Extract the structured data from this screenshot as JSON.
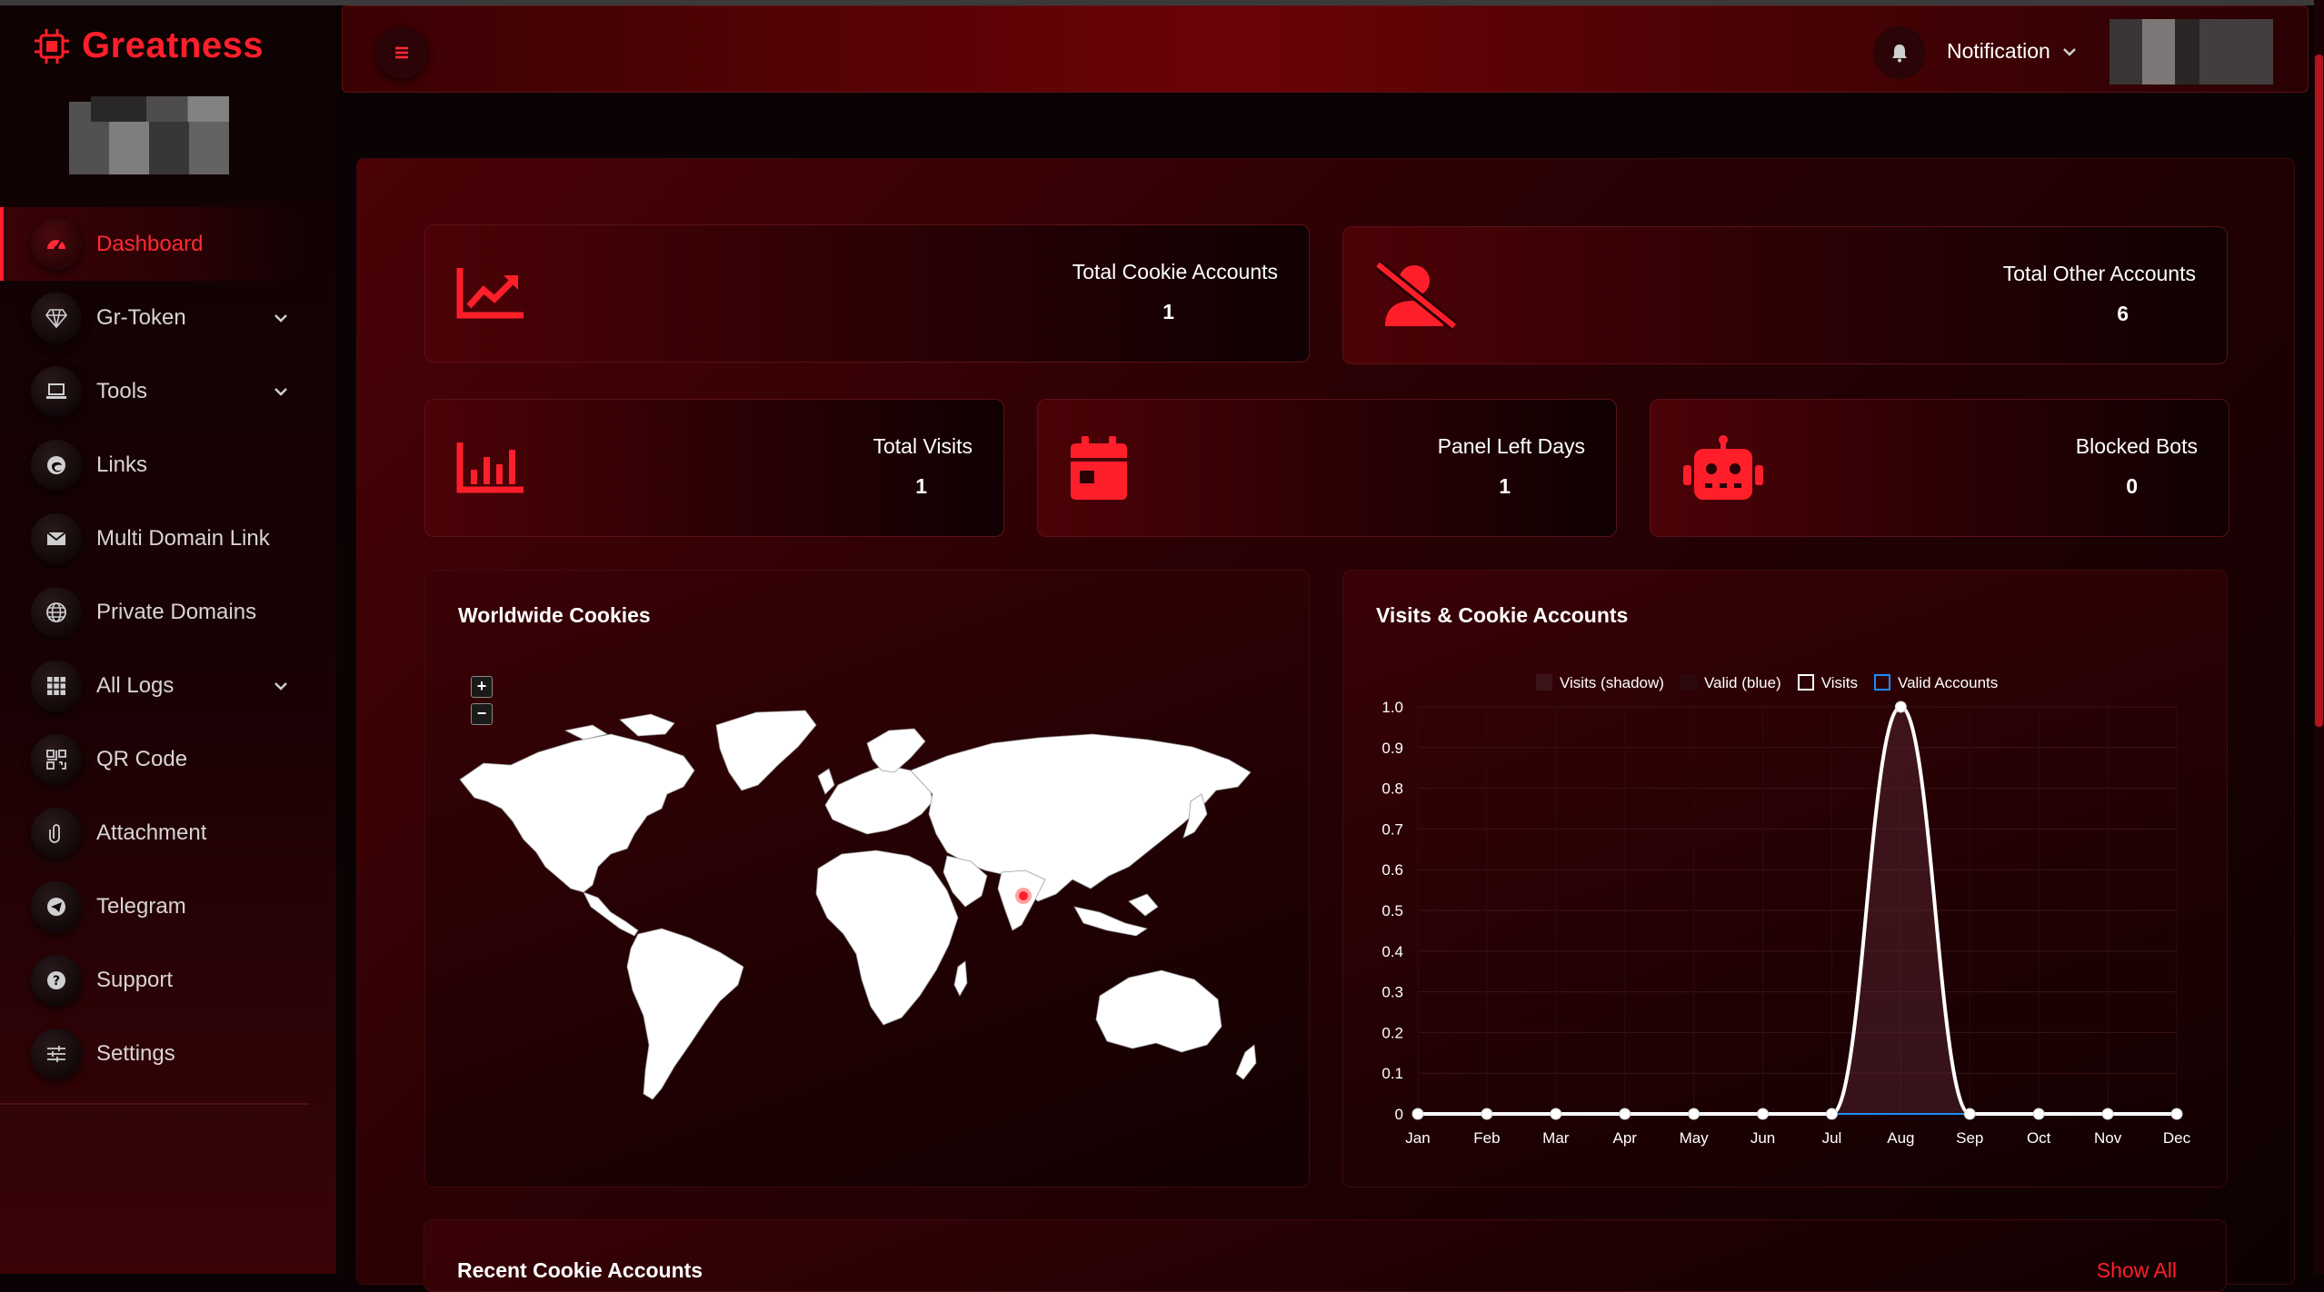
{
  "brand": {
    "name": "Greatness",
    "accent": "#ff1f2a"
  },
  "sidebar": {
    "items": [
      {
        "label": "Dashboard",
        "icon": "speedometer-icon",
        "active": true,
        "chevron": false
      },
      {
        "label": "Gr-Token",
        "icon": "diamond-icon",
        "active": false,
        "chevron": true
      },
      {
        "label": "Tools",
        "icon": "laptop-icon",
        "active": false,
        "chevron": true
      },
      {
        "label": "Links",
        "icon": "edge-browser-icon",
        "active": false,
        "chevron": false
      },
      {
        "label": "Multi Domain Link",
        "icon": "envelope-icon",
        "active": false,
        "chevron": false
      },
      {
        "label": "Private Domains",
        "icon": "globe-icon",
        "active": false,
        "chevron": false
      },
      {
        "label": "All Logs",
        "icon": "grid-icon",
        "active": false,
        "chevron": true
      },
      {
        "label": "QR Code",
        "icon": "qr-code-icon",
        "active": false,
        "chevron": false
      },
      {
        "label": "Attachment",
        "icon": "paperclip-icon",
        "active": false,
        "chevron": false
      },
      {
        "label": "Telegram",
        "icon": "telegram-icon",
        "active": false,
        "chevron": false
      },
      {
        "label": "Support",
        "icon": "question-icon",
        "active": false,
        "chevron": false
      },
      {
        "label": "Settings",
        "icon": "sliders-icon",
        "active": false,
        "chevron": false
      }
    ]
  },
  "header": {
    "notification_label": "Notification"
  },
  "stats": {
    "cookie_accounts": {
      "label": "Total Cookie Accounts",
      "value": "1",
      "icon": "trending-chart-icon"
    },
    "other_accounts": {
      "label": "Total Other Accounts",
      "value": "6",
      "icon": "user-slash-icon"
    },
    "visits": {
      "label": "Total Visits",
      "value": "1",
      "icon": "bar-chart-icon"
    },
    "panel_days": {
      "label": "Panel Left Days",
      "value": "1",
      "icon": "calendar-icon"
    },
    "blocked_bots": {
      "label": "Blocked Bots",
      "value": "0",
      "icon": "robot-icon"
    }
  },
  "map": {
    "title": "Worldwide Cookies",
    "zoom_in": "+",
    "zoom_out": "−",
    "marker": "India"
  },
  "chart": {
    "title": "Visits & Cookie Accounts",
    "legend": [
      "Visits (shadow)",
      "Valid (blue)",
      "Visits",
      "Valid Accounts"
    ]
  },
  "chart_data": {
    "type": "line",
    "categories": [
      "Jan",
      "Feb",
      "Mar",
      "Apr",
      "May",
      "Jun",
      "Jul",
      "Aug",
      "Sep",
      "Oct",
      "Nov",
      "Dec"
    ],
    "series": [
      {
        "name": "Visits",
        "values": [
          0,
          0,
          0,
          0,
          0,
          0,
          0,
          1,
          0,
          0,
          0,
          0
        ]
      },
      {
        "name": "Valid Accounts",
        "values": [
          0,
          0,
          0,
          0,
          0,
          0,
          0,
          0,
          0,
          0,
          0,
          0
        ]
      }
    ],
    "yticks": [
      "0",
      "0.1",
      "0.2",
      "0.3",
      "0.4",
      "0.5",
      "0.6",
      "0.7",
      "0.8",
      "0.9",
      "1.0"
    ],
    "ylim": [
      0,
      1
    ],
    "title": "Visits & Cookie Accounts",
    "legend_position": "top"
  },
  "recent": {
    "title": "Recent Cookie Accounts",
    "show_all": "Show All"
  }
}
